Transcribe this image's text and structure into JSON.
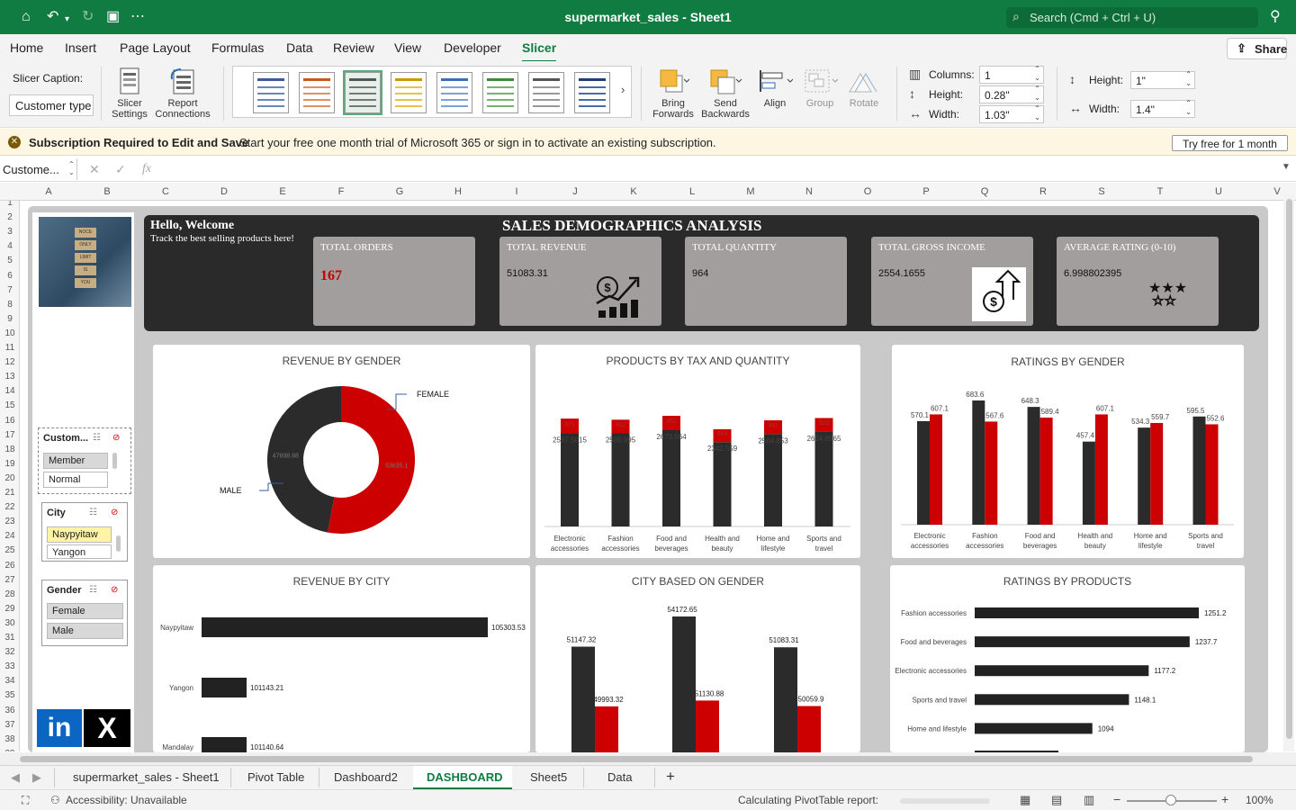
{
  "window": {
    "title": "supermarket_sales - Sheet1",
    "search_placeholder": "Search (Cmd + Ctrl + U)"
  },
  "menu": [
    "Home",
    "Insert",
    "Page Layout",
    "Formulas",
    "Data",
    "Review",
    "View",
    "Developer",
    "Slicer"
  ],
  "share_label": "Share",
  "ribbon": {
    "slicer_caption_label": "Slicer Caption:",
    "slicer_caption_value": "Customer type",
    "slicer_settings": [
      "Slicer",
      "Settings"
    ],
    "report_connections": [
      "Report",
      "Connections"
    ],
    "bring_forwards": [
      "Bring",
      "Forwards"
    ],
    "send_backwards": [
      "Send",
      "Backwards"
    ],
    "align": "Align",
    "group": "Group",
    "rotate": "Rotate",
    "columns_label": "Columns:",
    "columns_value": "1",
    "button_height_label": "Height:",
    "button_height_value": "0.28\"",
    "button_width_label": "Width:",
    "button_width_value": "1.03\"",
    "size_height_label": "Height:",
    "size_height_value": "1\"",
    "size_width_label": "Width:",
    "size_width_value": "1.4\""
  },
  "notice": {
    "title": "Subscription Required to Edit and Save",
    "text": "Start your free one month trial of Microsoft 365 or sign in to activate an existing subscription.",
    "button": "Try free for 1 month"
  },
  "name_box": "Custome...",
  "columns": [
    "A",
    "B",
    "C",
    "D",
    "E",
    "F",
    "G",
    "H",
    "I",
    "J",
    "K",
    "L",
    "M",
    "N",
    "O",
    "P",
    "Q",
    "R",
    "S",
    "T",
    "U",
    "V"
  ],
  "rows": [
    "1",
    "2",
    "3",
    "4",
    "5",
    "6",
    "7",
    "8",
    "9",
    "10",
    "11",
    "12",
    "13",
    "14",
    "15",
    "16",
    "17",
    "18",
    "19",
    "20",
    "21",
    "22",
    "23",
    "24",
    "25",
    "26",
    "27",
    "28",
    "29",
    "30",
    "31",
    "32",
    "33",
    "34",
    "35",
    "36",
    "37",
    "38",
    "39"
  ],
  "photo_words": [
    "NOCE",
    "ONLY",
    "LIMIT",
    "IS",
    "YOU"
  ],
  "slicers": {
    "customer": {
      "title": "Custom...",
      "items": [
        "Member",
        "Normal"
      ]
    },
    "city": {
      "title": "City",
      "items": [
        "Naypyitaw",
        "Yangon"
      ]
    },
    "gender": {
      "title": "Gender",
      "items": [
        "Female",
        "Male"
      ]
    }
  },
  "social": {
    "linkedin": "in",
    "x": "X"
  },
  "dashboard": {
    "hello": "Hello, Welcome",
    "tagline": "Track the best selling products here!",
    "title": "SALES DEMOGRAPHICS ANALYSIS"
  },
  "kpis": [
    {
      "title": "TOTAL ORDERS",
      "value": "167"
    },
    {
      "title": "TOTAL REVENUE",
      "value": "51083.31"
    },
    {
      "title": "TOTAL QUANTITY",
      "value": "964"
    },
    {
      "title": "TOTAL GROSS INCOME",
      "value": "2554.1655"
    },
    {
      "title": "AVERAGE RATING (0-10)",
      "value": "6.998802395"
    }
  ],
  "chart_data": [
    {
      "type": "pie",
      "title": "REVENUE BY GENDER",
      "labels": [
        "FEMALE",
        "MALE"
      ],
      "values": [
        53635.1,
        47698.88
      ],
      "value_labels": [
        "53635.1",
        "47698.88"
      ],
      "colors": [
        "#cc0000",
        "#2b2b2b"
      ]
    },
    {
      "type": "bar",
      "title": "PRODUCTS BY TAX AND QUANTITY",
      "categories": [
        [
          "Electronic",
          "accessories"
        ],
        [
          "Fashion",
          "accessories"
        ],
        [
          "Food and",
          "beverages"
        ],
        [
          "Health and",
          "beauty"
        ],
        [
          "Home and",
          "lifestyle"
        ],
        [
          "Sports and",
          "travel"
        ]
      ],
      "series": [
        {
          "values": [
            2587.5,
            2585.995,
            2673.564,
            2342.559,
            2564.853,
            2624.8965
          ],
          "labels": [
            "2587.5015",
            "2585.995",
            "2673.564",
            "2342.559",
            "2564.853",
            "2624.8965"
          ]
        },
        {
          "values": [
            971,
            902,
            952,
            854,
            911,
            920
          ],
          "labels": [
            "971",
            "902",
            "952",
            "854",
            "911",
            "920"
          ]
        }
      ],
      "colors": [
        "#2b2b2b",
        "#cc0000"
      ]
    },
    {
      "type": "bar",
      "title": "RATINGS BY GENDER",
      "categories": [
        [
          "Electronic",
          "accessories"
        ],
        [
          "Fashion",
          "accessories"
        ],
        [
          "Food and",
          "beverages"
        ],
        [
          "Health and",
          "beauty"
        ],
        [
          "Home and",
          "lifestyle"
        ],
        [
          "Sports and",
          "travel"
        ]
      ],
      "series": [
        {
          "values": [
            570.1,
            683.6,
            648.3,
            457.4,
            534.3,
            595.5
          ],
          "labels": [
            "570.1",
            "683.6",
            "648.3",
            "457.4",
            "534.3",
            "595.5"
          ]
        },
        {
          "values": [
            607.1,
            567.6,
            589.4,
            607.1,
            559.7,
            552.6
          ],
          "labels": [
            "607.1",
            "567.6",
            "589.4",
            "607.1",
            "559.7",
            "552.6"
          ]
        }
      ],
      "colors": [
        "#2b2b2b",
        "#cc0000"
      ]
    },
    {
      "type": "bar",
      "orientation": "horizontal",
      "title": "REVENUE BY CITY",
      "categories": [
        "Naypyitaw",
        "Yangon",
        "Mandalay"
      ],
      "values": [
        105303.53,
        101143.21,
        101140.64
      ],
      "labels": [
        "105303.53",
        "101143.21",
        "101140.64"
      ]
    },
    {
      "type": "bar",
      "title": "CITY BASED ON GENDER",
      "series": [
        {
          "values": [
            51147.32,
            54172.65,
            51083.31
          ],
          "labels": [
            "51147.32",
            "54172.65",
            "51083.31"
          ]
        },
        {
          "values": [
            49993.32,
            51130.88,
            50059.9
          ],
          "labels": [
            "49993.32",
            "51130.88",
            "50059.9"
          ]
        }
      ],
      "colors": [
        "#2b2b2b",
        "#cc0000"
      ]
    },
    {
      "type": "bar",
      "orientation": "horizontal",
      "title": "RATINGS BY PRODUCTS",
      "categories": [
        "Fashion accessories",
        "Food and beverages",
        "Electronic accessories",
        "Sports and travel",
        "Home and lifestyle"
      ],
      "values": [
        1251.2,
        1237.7,
        1177.2,
        1148.1,
        1094
      ],
      "labels": [
        "1251.2",
        "1237.7",
        "1177.2",
        "1148.1",
        "1094"
      ]
    }
  ],
  "sheets": [
    "supermarket_sales - Sheet1",
    "Pivot Table",
    "Dashboard2",
    "DASHBOARD",
    "Sheet5",
    "Data"
  ],
  "status": {
    "accessibility": "Accessibility: Unavailable",
    "calculating": "Calculating PivotTable report:",
    "zoom": "100%"
  }
}
